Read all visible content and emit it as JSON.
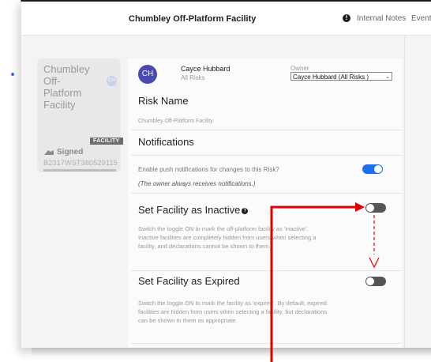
{
  "topbar": {
    "title": "Chumbley Off-Platform Facility",
    "internal_notes": "Internal Notes",
    "events": "Events"
  },
  "card": {
    "name": "Chumbley Off-Platform Facility",
    "avatar_initials": "CH",
    "tag": "FACILITY",
    "signed": "Signed",
    "code": "B2317WST380529115"
  },
  "owner": {
    "initials": "CH",
    "name": "Cayce Hubbard",
    "role": "All Risks",
    "label": "Owner",
    "selected": "Cayce Hubbard (All Risks )"
  },
  "risk": {
    "title": "Risk Name",
    "value": "Chumbley Off-Platform Facility"
  },
  "notifications": {
    "title": "Notifications",
    "text": "Enable push notifications for changes to this Risk?",
    "note": "(The owner always receives notifications.)",
    "enabled": true
  },
  "inactive": {
    "title": "Set Facility as Inactive",
    "desc": "Switch the toggle ON to mark the off-platform facility as 'inactive'. Inactive facilities are completely hidden from users when selecting a facility, and declarations cannot be shown to them.",
    "enabled": false
  },
  "expired": {
    "title": "Set Facility as Expired",
    "desc": "Switch the toggle ON to mark the facility as 'expired'. By default, expired facilities are hidden from users when selecting a facility, but declarations can be shown to them as appropriate.",
    "enabled": false
  },
  "colors": {
    "toggle_on": "#1d6ff2",
    "toggle_off": "#555555",
    "annotation": "#e00000",
    "avatar": "#4a4ab0"
  }
}
